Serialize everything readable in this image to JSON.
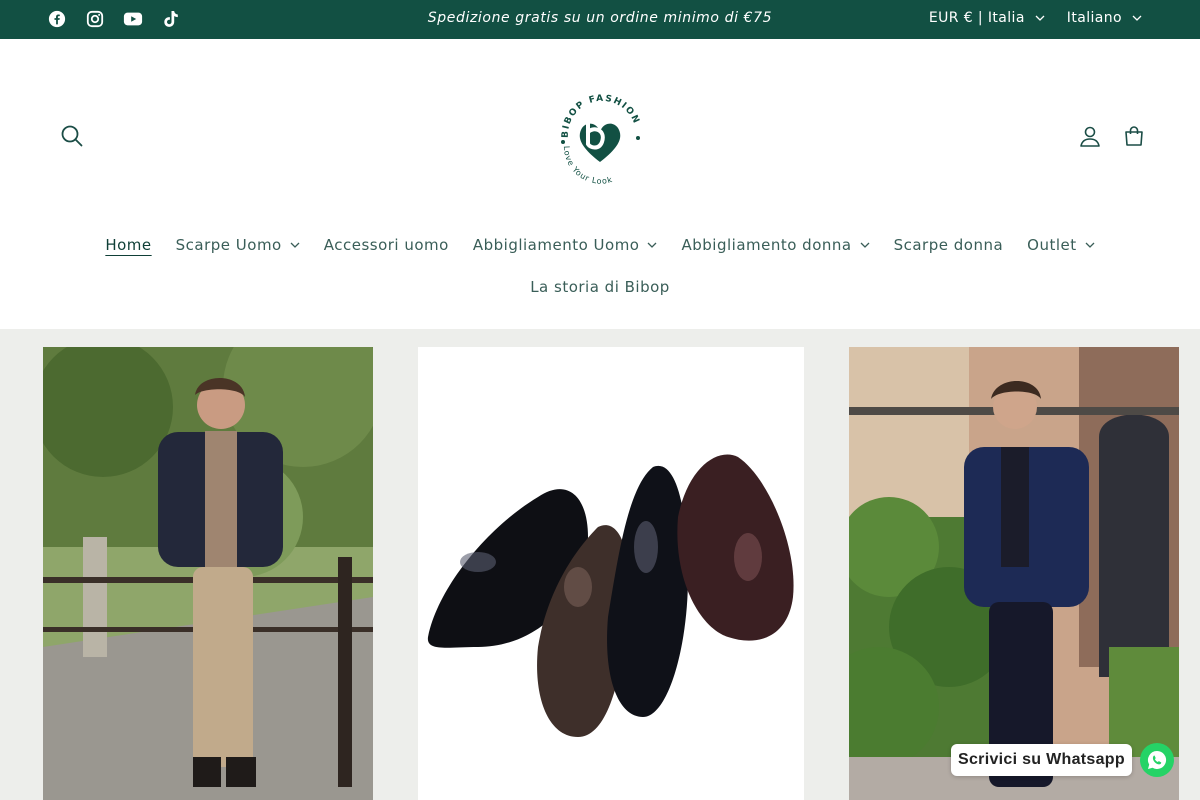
{
  "announcement": {
    "text": "Spedizione gratis su un ordine minimo di €75",
    "background": "#125043"
  },
  "social": [
    {
      "icon": "facebook-icon"
    },
    {
      "icon": "instagram-icon"
    },
    {
      "icon": "youtube-icon"
    },
    {
      "icon": "tiktok-icon"
    }
  ],
  "selectors": {
    "currency": "EUR € | Italia",
    "language": "Italiano"
  },
  "header": {
    "logo_text_top": "BIBOP FASHION",
    "logo_text_bottom": "Love Your Look",
    "icons": [
      "search-icon",
      "account-icon",
      "cart-icon"
    ]
  },
  "nav": {
    "items": [
      {
        "label": "Home",
        "active": true,
        "dropdown": false
      },
      {
        "label": "Scarpe Uomo",
        "dropdown": true
      },
      {
        "label": "Accessori uomo",
        "dropdown": false
      },
      {
        "label": "Abbigliamento Uomo",
        "dropdown": true
      },
      {
        "label": "Abbigliamento donna",
        "dropdown": true
      },
      {
        "label": "Scarpe donna",
        "dropdown": false
      },
      {
        "label": "Outlet",
        "dropdown": true
      }
    ],
    "second_row": "La storia di Bibop"
  },
  "whatsapp": {
    "label": "Scrivici su Whatsapp",
    "color": "#25d366"
  },
  "colors": {
    "brand": "#125043",
    "nav_text": "#3a5e58",
    "gallery_bg": "#edeeeb"
  }
}
